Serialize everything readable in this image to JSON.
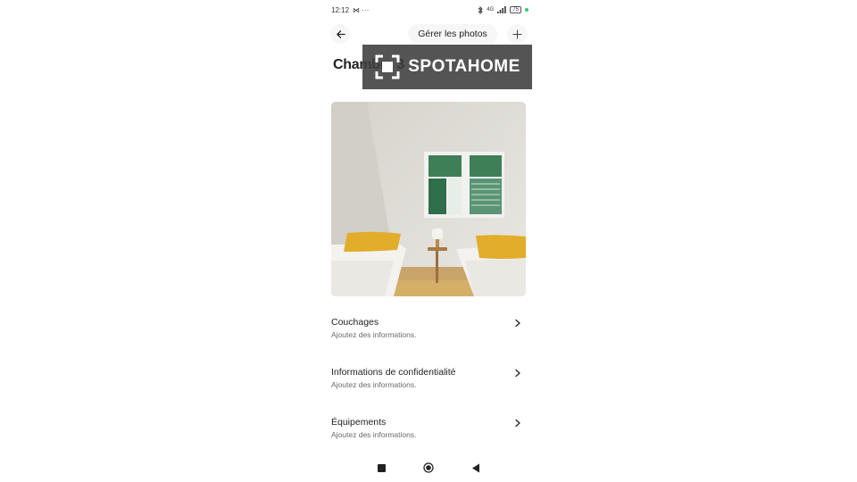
{
  "status_bar": {
    "time": "12:12",
    "left_icons": "⋈ ···",
    "network": "4G",
    "battery": "75"
  },
  "header": {
    "manage_photos_label": "Gérer les photos"
  },
  "room": {
    "title": "Chambre 3"
  },
  "watermark": {
    "brand": "SPOTAHOME"
  },
  "sections": [
    {
      "title": "Couchages",
      "subtitle": "Ajoutez des informations."
    },
    {
      "title": "Informations de confidentialité",
      "subtitle": "Ajoutez des informations."
    },
    {
      "title": "Équipements",
      "subtitle": "Ajoutez des informations."
    }
  ],
  "colors": {
    "pillow": "#e2ad2a",
    "shutter": "#3f7f58",
    "accent_dark": "#222222"
  }
}
